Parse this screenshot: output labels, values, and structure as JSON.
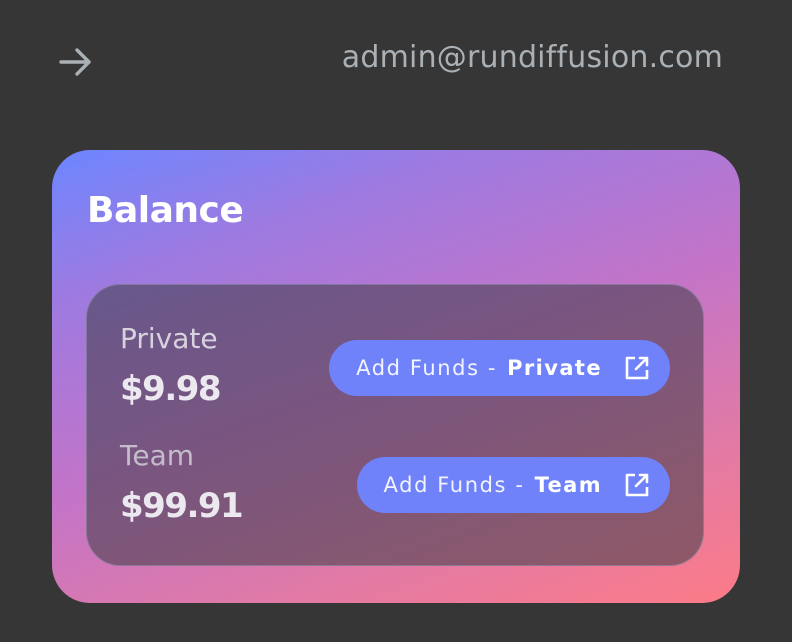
{
  "header": {
    "back_icon": "arrow-right-icon",
    "email": "admin@rundiffusion.com"
  },
  "balance": {
    "title": "Balance",
    "private": {
      "label": "Private",
      "amount": "$9.98",
      "button_prefix": "Add Funds  -",
      "button_strong": "Private",
      "button_icon": "external-link-icon"
    },
    "team": {
      "label": "Team",
      "amount": "$99.91",
      "button_prefix": "Add Funds -",
      "button_strong": "Team",
      "button_icon": "external-link-icon"
    }
  },
  "colors": {
    "background": "#363636",
    "button": "#6f82fa",
    "gradient_start": "#6c86ff",
    "gradient_end": "#fc7b87"
  }
}
